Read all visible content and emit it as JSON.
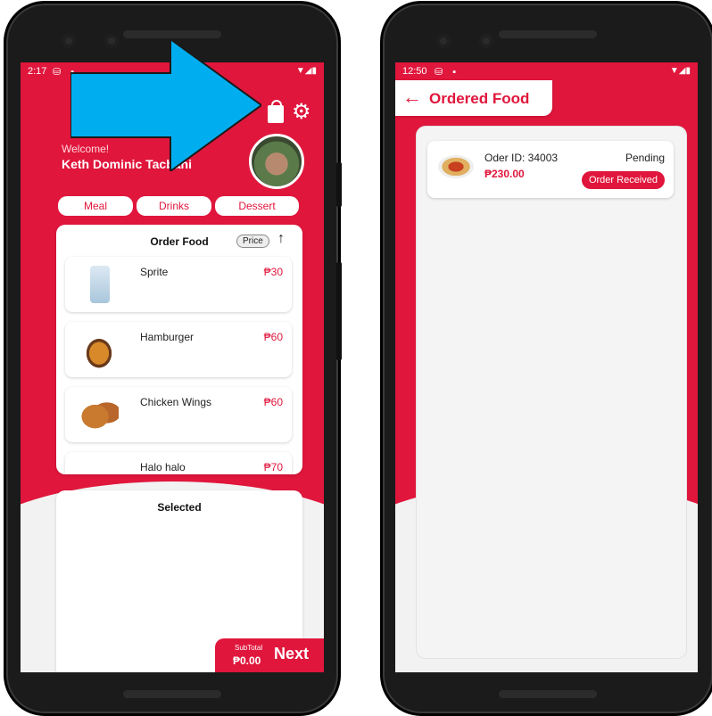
{
  "left_screen": {
    "status": {
      "time": "2:17"
    },
    "welcome_label": "Welcome!",
    "user_name": "Keth Dominic Tacbani",
    "categories": [
      "Meal",
      "Drinks",
      "Dessert"
    ],
    "order_panel": {
      "title": "Order Food",
      "sort_chip": "Price"
    },
    "foods": [
      {
        "name": "Sprite",
        "price": "₱30"
      },
      {
        "name": "Hamburger",
        "price": "₱60"
      },
      {
        "name": "Chicken Wings",
        "price": "₱60"
      },
      {
        "name": "Halo halo",
        "price": "₱70"
      }
    ],
    "selected_title": "Selected",
    "subtotal_label": "SubTotal",
    "subtotal_value": "₱0.00",
    "next_label": "Next",
    "accent_color": "#e0163c",
    "annotation_arrow_color": "#00aeef"
  },
  "right_screen": {
    "status": {
      "time": "12:50"
    },
    "header_title": "Ordered Food",
    "orders": [
      {
        "id_label": "Oder ID: 34003",
        "total": "₱230.00",
        "status": "Pending",
        "action": "Order Received"
      }
    ]
  }
}
